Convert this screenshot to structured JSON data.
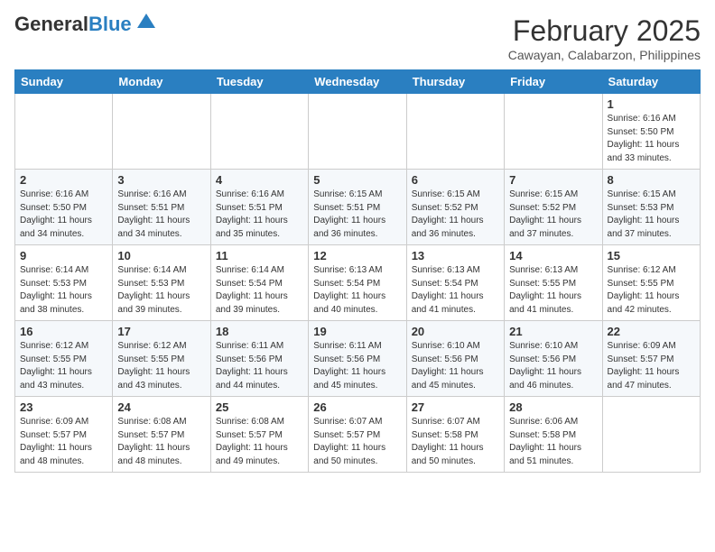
{
  "header": {
    "logo_general": "General",
    "logo_blue": "Blue",
    "month_year": "February 2025",
    "location": "Cawayan, Calabarzon, Philippines"
  },
  "days_of_week": [
    "Sunday",
    "Monday",
    "Tuesday",
    "Wednesday",
    "Thursday",
    "Friday",
    "Saturday"
  ],
  "weeks": [
    [
      {
        "day": "",
        "info": ""
      },
      {
        "day": "",
        "info": ""
      },
      {
        "day": "",
        "info": ""
      },
      {
        "day": "",
        "info": ""
      },
      {
        "day": "",
        "info": ""
      },
      {
        "day": "",
        "info": ""
      },
      {
        "day": "1",
        "info": "Sunrise: 6:16 AM\nSunset: 5:50 PM\nDaylight: 11 hours and 33 minutes."
      }
    ],
    [
      {
        "day": "2",
        "info": "Sunrise: 6:16 AM\nSunset: 5:50 PM\nDaylight: 11 hours and 34 minutes."
      },
      {
        "day": "3",
        "info": "Sunrise: 6:16 AM\nSunset: 5:51 PM\nDaylight: 11 hours and 34 minutes."
      },
      {
        "day": "4",
        "info": "Sunrise: 6:16 AM\nSunset: 5:51 PM\nDaylight: 11 hours and 35 minutes."
      },
      {
        "day": "5",
        "info": "Sunrise: 6:15 AM\nSunset: 5:51 PM\nDaylight: 11 hours and 36 minutes."
      },
      {
        "day": "6",
        "info": "Sunrise: 6:15 AM\nSunset: 5:52 PM\nDaylight: 11 hours and 36 minutes."
      },
      {
        "day": "7",
        "info": "Sunrise: 6:15 AM\nSunset: 5:52 PM\nDaylight: 11 hours and 37 minutes."
      },
      {
        "day": "8",
        "info": "Sunrise: 6:15 AM\nSunset: 5:53 PM\nDaylight: 11 hours and 37 minutes."
      }
    ],
    [
      {
        "day": "9",
        "info": "Sunrise: 6:14 AM\nSunset: 5:53 PM\nDaylight: 11 hours and 38 minutes."
      },
      {
        "day": "10",
        "info": "Sunrise: 6:14 AM\nSunset: 5:53 PM\nDaylight: 11 hours and 39 minutes."
      },
      {
        "day": "11",
        "info": "Sunrise: 6:14 AM\nSunset: 5:54 PM\nDaylight: 11 hours and 39 minutes."
      },
      {
        "day": "12",
        "info": "Sunrise: 6:13 AM\nSunset: 5:54 PM\nDaylight: 11 hours and 40 minutes."
      },
      {
        "day": "13",
        "info": "Sunrise: 6:13 AM\nSunset: 5:54 PM\nDaylight: 11 hours and 41 minutes."
      },
      {
        "day": "14",
        "info": "Sunrise: 6:13 AM\nSunset: 5:55 PM\nDaylight: 11 hours and 41 minutes."
      },
      {
        "day": "15",
        "info": "Sunrise: 6:12 AM\nSunset: 5:55 PM\nDaylight: 11 hours and 42 minutes."
      }
    ],
    [
      {
        "day": "16",
        "info": "Sunrise: 6:12 AM\nSunset: 5:55 PM\nDaylight: 11 hours and 43 minutes."
      },
      {
        "day": "17",
        "info": "Sunrise: 6:12 AM\nSunset: 5:55 PM\nDaylight: 11 hours and 43 minutes."
      },
      {
        "day": "18",
        "info": "Sunrise: 6:11 AM\nSunset: 5:56 PM\nDaylight: 11 hours and 44 minutes."
      },
      {
        "day": "19",
        "info": "Sunrise: 6:11 AM\nSunset: 5:56 PM\nDaylight: 11 hours and 45 minutes."
      },
      {
        "day": "20",
        "info": "Sunrise: 6:10 AM\nSunset: 5:56 PM\nDaylight: 11 hours and 45 minutes."
      },
      {
        "day": "21",
        "info": "Sunrise: 6:10 AM\nSunset: 5:56 PM\nDaylight: 11 hours and 46 minutes."
      },
      {
        "day": "22",
        "info": "Sunrise: 6:09 AM\nSunset: 5:57 PM\nDaylight: 11 hours and 47 minutes."
      }
    ],
    [
      {
        "day": "23",
        "info": "Sunrise: 6:09 AM\nSunset: 5:57 PM\nDaylight: 11 hours and 48 minutes."
      },
      {
        "day": "24",
        "info": "Sunrise: 6:08 AM\nSunset: 5:57 PM\nDaylight: 11 hours and 48 minutes."
      },
      {
        "day": "25",
        "info": "Sunrise: 6:08 AM\nSunset: 5:57 PM\nDaylight: 11 hours and 49 minutes."
      },
      {
        "day": "26",
        "info": "Sunrise: 6:07 AM\nSunset: 5:57 PM\nDaylight: 11 hours and 50 minutes."
      },
      {
        "day": "27",
        "info": "Sunrise: 6:07 AM\nSunset: 5:58 PM\nDaylight: 11 hours and 50 minutes."
      },
      {
        "day": "28",
        "info": "Sunrise: 6:06 AM\nSunset: 5:58 PM\nDaylight: 11 hours and 51 minutes."
      },
      {
        "day": "",
        "info": ""
      }
    ]
  ]
}
